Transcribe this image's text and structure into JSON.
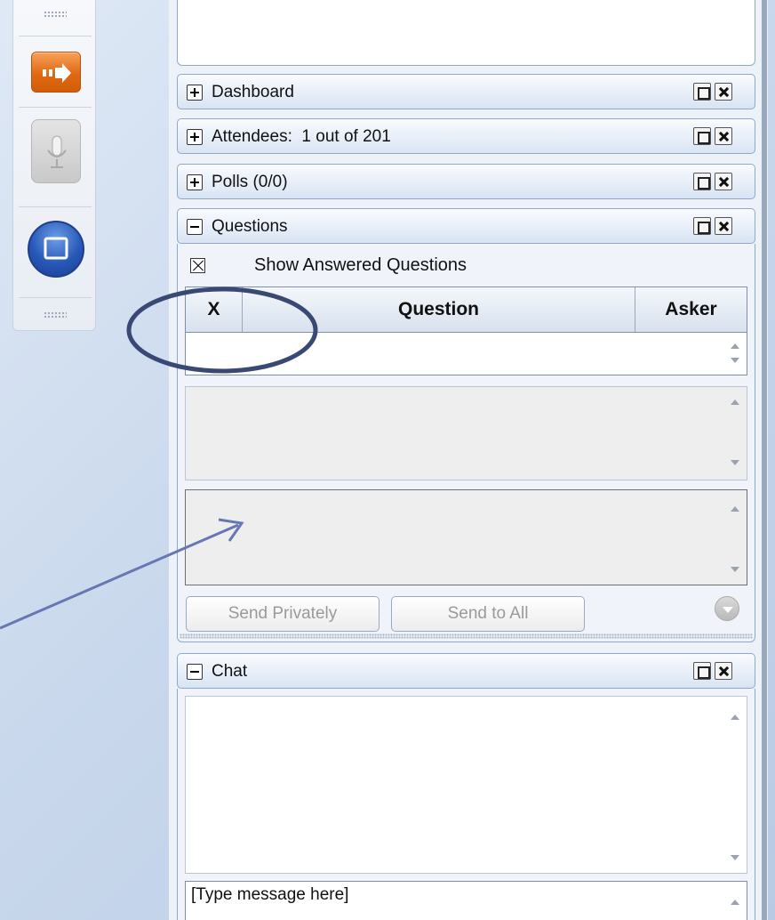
{
  "toolbar": {
    "buttons": [
      {
        "name": "show-hide-arrow",
        "icon": "arrow-right-icon"
      },
      {
        "name": "microphone",
        "icon": "microphone-icon"
      },
      {
        "name": "screen-share",
        "icon": "square-stop-icon"
      }
    ]
  },
  "panels": {
    "dashboard": {
      "title": "Dashboard"
    },
    "attendees": {
      "title": "Attendees:  1 out of 201"
    },
    "polls": {
      "title": "Polls (0/0)"
    },
    "questions": {
      "title": "Questions",
      "show_answered_label": "Show Answered Questions",
      "columns": [
        "X",
        "Question",
        "Asker"
      ],
      "send_privately_label": "Send Privately",
      "send_to_all_label": "Send to All"
    },
    "chat": {
      "title": "Chat",
      "input_value": "[Type message here]"
    }
  },
  "colors": {
    "accent_orange": "#e06a12",
    "annotation_navy": "#3a4874",
    "annotation_arrow": "#6777b4",
    "panel_border": "#8fa7c8"
  }
}
